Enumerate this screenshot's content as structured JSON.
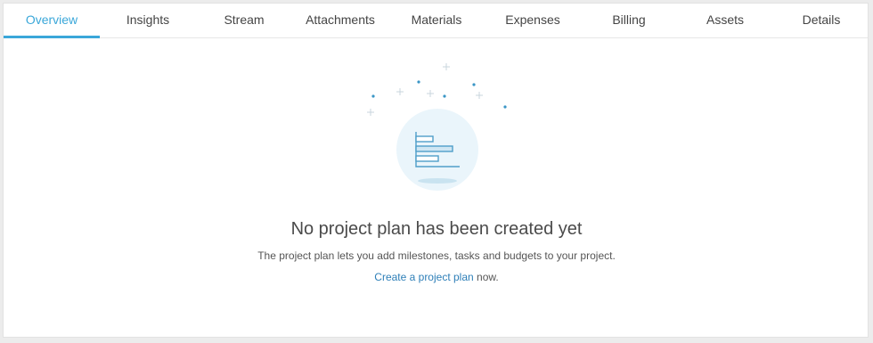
{
  "tabs": [
    {
      "label": "Overview",
      "active": true
    },
    {
      "label": "Insights",
      "active": false
    },
    {
      "label": "Stream",
      "active": false
    },
    {
      "label": "Attachments",
      "active": false
    },
    {
      "label": "Materials",
      "active": false
    },
    {
      "label": "Expenses",
      "active": false
    },
    {
      "label": "Billing",
      "active": false
    },
    {
      "label": "Assets",
      "active": false
    },
    {
      "label": "Details",
      "active": false
    }
  ],
  "empty_state": {
    "illustration_icon": "bar-chart-icon",
    "title": "No project plan has been created yet",
    "description": "The project plan lets you add milestones, tasks and budgets to your project.",
    "cta_link": "Create a project plan",
    "cta_suffix": " now."
  },
  "colors": {
    "accent": "#3aa7d9",
    "link": "#2e7fb8",
    "illustration_bg": "#eaf5fb"
  }
}
